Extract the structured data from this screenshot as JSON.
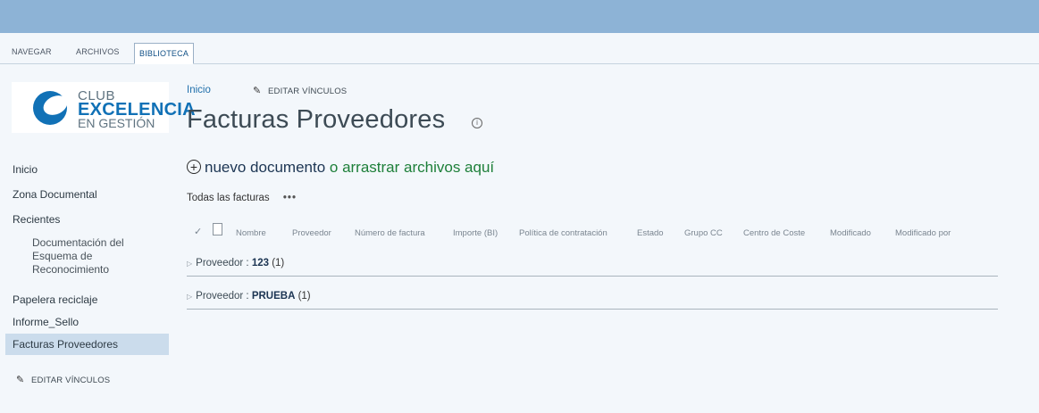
{
  "ribbon": {
    "tabs": [
      "NAVEGAR",
      "ARCHIVOS",
      "BIBLIOTECA"
    ]
  },
  "logo": {
    "line1": "CLUB",
    "line2": "EXCELENCIA",
    "line3": "EN GESTIÓN"
  },
  "nav": {
    "items": [
      "Inicio",
      "Zona Documental",
      "Recientes",
      "Documentación del",
      "Esquema de",
      "Reconocimiento",
      "Papelera reciclaje",
      "Informe_Sello",
      "Facturas Proveedores"
    ],
    "edit_links": "EDITAR VÍNCULOS"
  },
  "breadcrumb": {
    "home": "Inicio",
    "edit_links": "EDITAR VÍNCULOS"
  },
  "page": {
    "title": "Facturas Proveedores",
    "info_icon": "i"
  },
  "actions": {
    "new_document": "nuevo documento",
    "drag_hint": "o arrastrar archivos aquí"
  },
  "view": {
    "name": "Todas las facturas",
    "more": "•••"
  },
  "columns": [
    "Nombre",
    "Proveedor",
    "Número de factura",
    "Importe (BI)",
    "Política de contratación",
    "Estado",
    "Grupo CC",
    "Centro de Coste",
    "Modificado",
    "Modificado por"
  ],
  "groups": [
    {
      "label": "Proveedor :",
      "value": "123",
      "count": "(1)"
    },
    {
      "label": "Proveedor :",
      "value": "PRUEBA",
      "count": "(1)"
    }
  ],
  "colors": {
    "topbar": "#8db3d6",
    "accent": "#1171b6",
    "link": "#1f6fab",
    "new_doc": "#1d7f39",
    "nav_selected": "#cbdcec"
  }
}
